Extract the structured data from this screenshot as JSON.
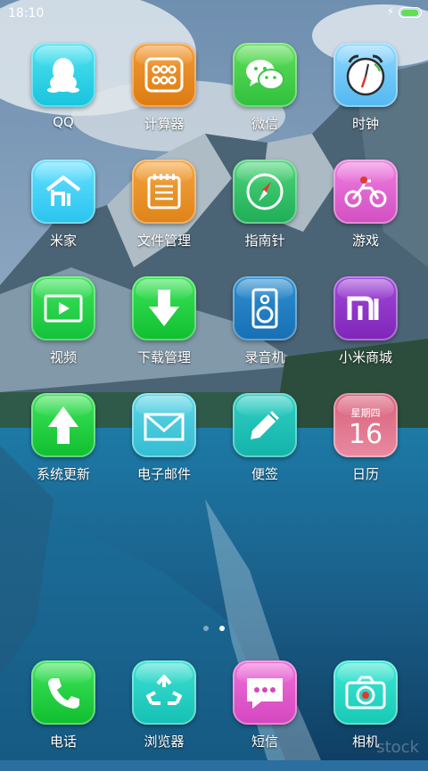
{
  "status": {
    "time": "18:10",
    "battery_level": 0.95
  },
  "pager": {
    "active_index": 1,
    "count": 2
  },
  "apps": {
    "qq": "QQ",
    "calculator": "计算器",
    "wechat": "微信",
    "clock": "时钟",
    "mijia": "米家",
    "file_manager": "文件管理",
    "compass": "指南针",
    "game": "游戏",
    "video": "视频",
    "downloads": "下载管理",
    "recorder": "录音机",
    "mi_store": "小米商城",
    "updater": "系统更新",
    "email": "电子邮件",
    "notes": "便签",
    "calendar": "日历"
  },
  "calendar_icon": {
    "weekday": "星期四",
    "day": "16"
  },
  "dock": {
    "phone": "电话",
    "browser": "浏览器",
    "messages": "短信",
    "camera": "相机"
  },
  "watermark": "stock"
}
